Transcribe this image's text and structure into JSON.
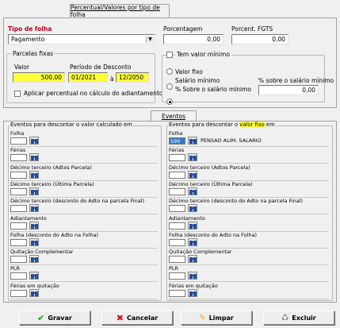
{
  "top_tab": {
    "label": "Percentual/Valores por tipo de folha"
  },
  "tipo_folha": {
    "label": "Tipo de folha",
    "value": "Pagamento"
  },
  "porcentagem": {
    "label": "Porcentagem",
    "value": "0,00"
  },
  "porcent_fgts": {
    "label": "Porcent. FGTS",
    "value": "0,00"
  },
  "parcelas": {
    "title": "Parcelas fixas",
    "valor_label": "Valor",
    "valor": "500,00",
    "periodo_label": "Período de Desconto",
    "periodo_inicio": "01/2021",
    "periodo_sep": "à",
    "periodo_fim": "12/2050",
    "aplicar_label": "Aplicar percentual no cálculo do adiantamento"
  },
  "valor_minimo": {
    "title": "Tem valor mínimo",
    "options": [
      "Valor fixo",
      "Salário mínimo",
      "% Sobre o salário mínimo"
    ],
    "selected_index": 2,
    "pct_label": "% sobre o salário mínimo",
    "pct_value": "0,00"
  },
  "eventos_tab": {
    "label": "Eventos"
  },
  "left_events": {
    "header": "Eventos para descontar o valor calculado em",
    "items": [
      {
        "label": "Folha",
        "code": "",
        "desc": ""
      },
      {
        "label": "Férias",
        "code": "",
        "desc": ""
      },
      {
        "label": "Décimo terceiro (Adtos Parcela)",
        "code": "",
        "desc": ""
      },
      {
        "label": "Décimo terceiro (Última Parcela)",
        "code": "",
        "desc": ""
      },
      {
        "label": "Décimo terceiro (desconto do Adto na parcela Final)",
        "code": "",
        "desc": ""
      },
      {
        "label": "Adiantamento",
        "code": "",
        "desc": ""
      },
      {
        "label": "Folha (desconto do Adto na Folha)",
        "code": "",
        "desc": ""
      },
      {
        "label": "Quitação Complementar",
        "code": "",
        "desc": ""
      },
      {
        "label": "PLR",
        "code": "",
        "desc": ""
      },
      {
        "label": "Férias em quitação",
        "code": "",
        "desc": ""
      }
    ]
  },
  "right_events": {
    "header_pre": "Eventos para descontar o",
    "header_highlight": "valor fixo",
    "header_post": "em",
    "items": [
      {
        "label": "Folha",
        "code": "590",
        "desc": "PENSAO ALIM. SALARIO"
      },
      {
        "label": "Férias",
        "code": "",
        "desc": ""
      },
      {
        "label": "Décimo terceiro (Adtos Parcela)",
        "code": "",
        "desc": ""
      },
      {
        "label": "Décimo terceiro (Última Parcela)",
        "code": "",
        "desc": ""
      },
      {
        "label": "Décimo terceiro (desconto do Adto na parcela Final)",
        "code": "",
        "desc": ""
      },
      {
        "label": "Adiantamento",
        "code": "",
        "desc": ""
      },
      {
        "label": "Folha (desconto do Adto na Folha)",
        "code": "",
        "desc": ""
      },
      {
        "label": "Quitação Complementar",
        "code": "",
        "desc": ""
      },
      {
        "label": "PLR",
        "code": "",
        "desc": ""
      },
      {
        "label": "Férias em quitação",
        "code": "",
        "desc": ""
      }
    ]
  },
  "buttons": {
    "gravar": "Gravar",
    "cancelar": "Cancelar",
    "limpar": "Limpar",
    "excluir": "Excluir"
  }
}
